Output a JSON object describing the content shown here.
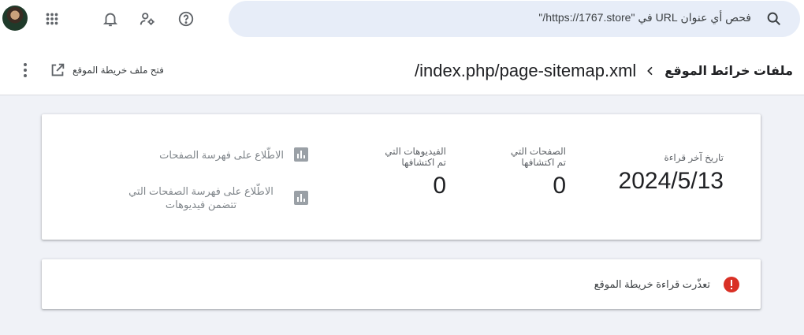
{
  "colors": {
    "accent": "#1a73e8",
    "error": "#d93025",
    "search_bg": "#e7edf8",
    "page_bg": "#f0f2f7",
    "chart_icon": "#9aa0a6"
  },
  "topbar": {
    "icons": [
      "avatar",
      "apps-grid-icon",
      "bell-icon",
      "manage-users-icon",
      "help-icon"
    ],
    "search": {
      "text": "فحص أي عنوان URL في \"https://1767.store/\"",
      "icon": "search-icon"
    }
  },
  "header": {
    "open_sitemap_label": "فتح ملف خريطة الموقع",
    "breadcrumb_parent": "ملفات خرائط الموقع",
    "breadcrumb_current": "/index.php/page-sitemap.xml"
  },
  "stats": {
    "last_read": {
      "label": "تاريخ آخر قراءة",
      "value": "2024/5/13"
    },
    "discovered_pages": {
      "label": "الصفحات التي تم اكتشافها",
      "value": "0"
    },
    "discovered_videos": {
      "label": "الفيديوهات التي تم اكتشافها",
      "value": "0"
    }
  },
  "reports": {
    "page_index": "الاطّلاع على فهرسة الصفحات",
    "video_index": "الاطّلاع على فهرسة الصفحات التي تتضمن فيديوهات"
  },
  "status": {
    "message": "تعذّرت قراءة خريطة الموقع",
    "icon": "error-icon"
  }
}
